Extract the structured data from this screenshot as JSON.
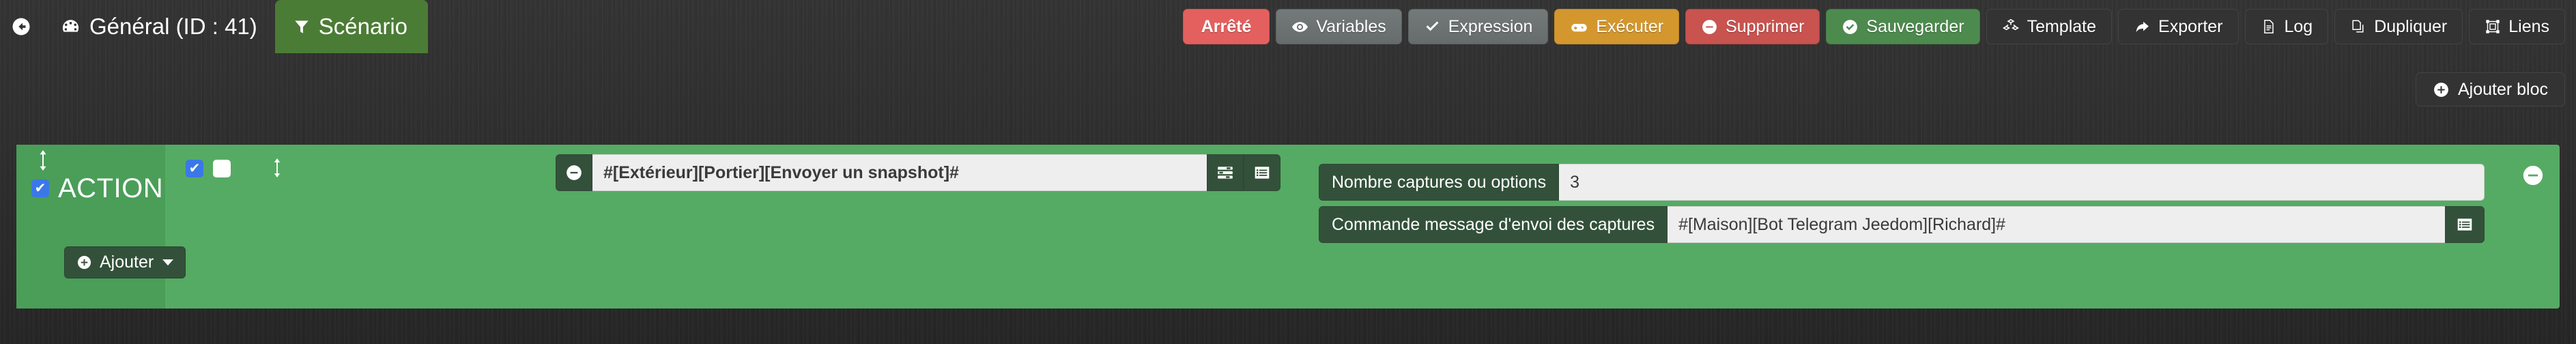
{
  "header": {
    "back_icon": "arrow-circle-left-icon",
    "title": "Général (ID : 41)",
    "title_icon": "dashboard-icon",
    "tab": {
      "label": "Scénario",
      "icon": "filter-icon"
    },
    "buttons": [
      {
        "label": "Arrêté",
        "icon": "",
        "style": "badge"
      },
      {
        "label": "Variables",
        "icon": "eye-icon",
        "style": "grey"
      },
      {
        "label": "Expression",
        "icon": "check-icon",
        "style": "grey"
      },
      {
        "label": "Exécuter",
        "icon": "gamepad-icon",
        "style": "orange"
      },
      {
        "label": "Supprimer",
        "icon": "minus-circle-icon",
        "style": "red"
      },
      {
        "label": "Sauvegarder",
        "icon": "check-circle-icon",
        "style": "green"
      },
      {
        "label": "Template",
        "icon": "cubes-icon",
        "style": "dark"
      },
      {
        "label": "Exporter",
        "icon": "share-icon",
        "style": "dark"
      },
      {
        "label": "Log",
        "icon": "file-text-icon",
        "style": "dark"
      },
      {
        "label": "Dupliquer",
        "icon": "copy-icon",
        "style": "dark"
      },
      {
        "label": "Liens",
        "icon": "object-group-icon",
        "style": "dark"
      }
    ]
  },
  "toolbar": {
    "add_block_label": "Ajouter bloc",
    "add_block_icon": "plus-circle-icon"
  },
  "block": {
    "title": "ACTION",
    "enabled_checked": true,
    "add_label": "Ajouter",
    "add_icon": "plus-circle-icon",
    "drag_icon": "arrows-v-icon",
    "action": {
      "checkbox_primary_checked": true,
      "checkbox_secondary_checked": false,
      "remove_icon": "minus-circle-icon",
      "command_value": "#[Extérieur][Portier][Envoyer un snapshot]#",
      "btn_sliders_icon": "sliders-icon",
      "btn_list_icon": "list-alt-icon",
      "remove_row_icon": "minus-circle-icon",
      "options": [
        {
          "label": "Nombre captures ou options",
          "value": "3",
          "addon_icon": ""
        },
        {
          "label": "Commande message d'envoi des captures",
          "value": "#[Maison][Bot Telegram Jeedom][Richard]#",
          "addon_icon": "list-alt-icon"
        }
      ]
    }
  },
  "colors": {
    "background": "#2b2b2b",
    "block_green": "#55ab63",
    "block_green_dark": "#4a9e58",
    "panel_dark_green": "#33513a",
    "accent_blue": "#3b78e7",
    "badge_red": "#e4605e",
    "orange": "#d4972e",
    "red": "#c9534f",
    "green": "#4d8a4e",
    "tab_green": "#4b7c35"
  }
}
